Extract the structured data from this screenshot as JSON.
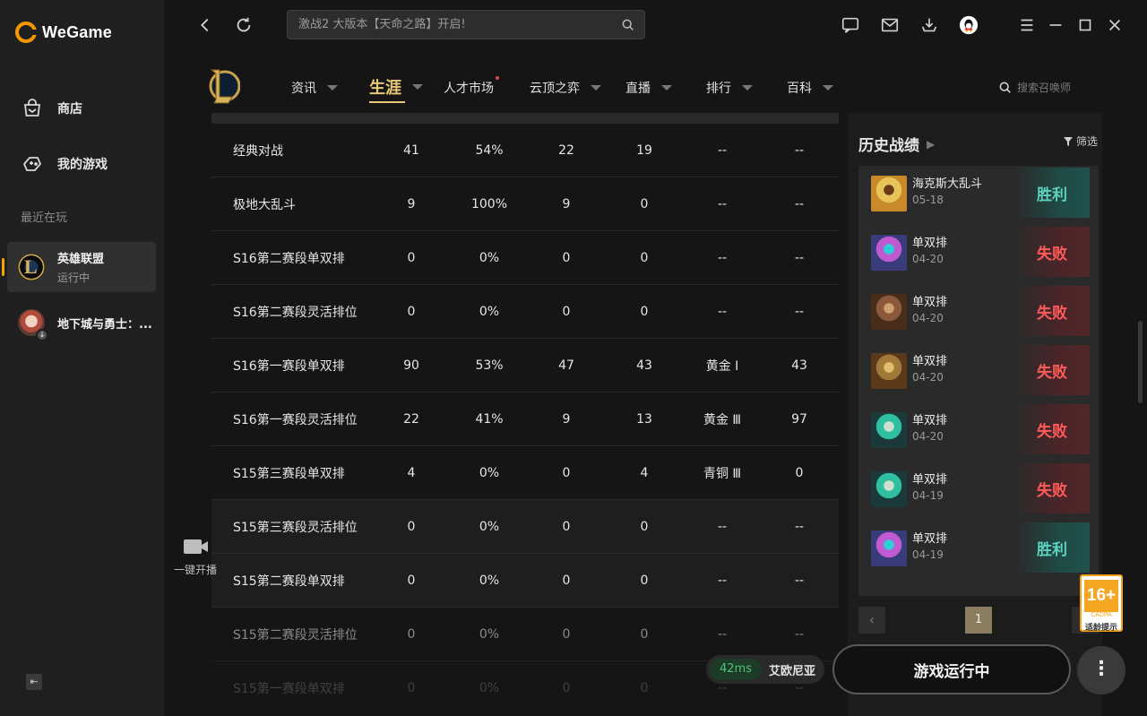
{
  "brand": {
    "name": "WeGame"
  },
  "sidebar": {
    "nav": [
      {
        "label": "商店",
        "icon": "shopping-bag-icon"
      },
      {
        "label": "我的游戏",
        "icon": "gamepad-icon"
      }
    ],
    "recent_label": "最近在玩",
    "games": [
      {
        "name": "英雄联盟",
        "status": "运行中",
        "active": true
      },
      {
        "name": "地下城与勇士：...",
        "status": "",
        "active": false
      }
    ]
  },
  "topbar": {
    "search_placeholder": "激战2 大版本【天命之路】开启!"
  },
  "gamenav": {
    "tabs": [
      {
        "label": "资讯",
        "active": false,
        "dot": false
      },
      {
        "label": "生涯",
        "active": true,
        "dot": false
      },
      {
        "label": "人才市场",
        "active": false,
        "dot": true
      },
      {
        "label": "云顶之弈",
        "active": false,
        "dot": false
      },
      {
        "label": "直播",
        "active": false,
        "dot": false
      },
      {
        "label": "排行",
        "active": false,
        "dot": false
      },
      {
        "label": "百科",
        "active": false,
        "dot": false
      }
    ],
    "search_placeholder": "搜索召唤师"
  },
  "stats_table": {
    "rows": [
      [
        "经典对战",
        "41",
        "54%",
        "22",
        "19",
        "--",
        "--"
      ],
      [
        "极地大乱斗",
        "9",
        "100%",
        "9",
        "0",
        "--",
        "--"
      ],
      [
        "S16第二赛段单双排",
        "0",
        "0%",
        "0",
        "0",
        "--",
        "--"
      ],
      [
        "S16第二赛段灵活排位",
        "0",
        "0%",
        "0",
        "0",
        "--",
        "--"
      ],
      [
        "S16第一赛段单双排",
        "90",
        "53%",
        "47",
        "43",
        "黄金 Ⅰ",
        "43"
      ],
      [
        "S16第一赛段灵活排位",
        "22",
        "41%",
        "9",
        "13",
        "黄金 Ⅲ",
        "97"
      ],
      [
        "S15第三赛段单双排",
        "4",
        "0%",
        "0",
        "4",
        "青铜 Ⅲ",
        "0"
      ],
      [
        "S15第三赛段灵活排位",
        "0",
        "0%",
        "0",
        "0",
        "--",
        "--"
      ],
      [
        "S15第二赛段单双排",
        "0",
        "0%",
        "0",
        "0",
        "--",
        "--"
      ],
      [
        "S15第二赛段灵活排位",
        "0",
        "0%",
        "0",
        "0",
        "--",
        "--"
      ],
      [
        "S15第一赛段单双排",
        "0",
        "0%",
        "0",
        "0",
        "--",
        "--"
      ]
    ]
  },
  "stream_button": {
    "label": "一键开播"
  },
  "history": {
    "title": "历史战绩",
    "filter_label": "筛选",
    "matches": [
      {
        "mode": "海克斯大乱斗",
        "date": "05-18",
        "result": "胜利",
        "win": true
      },
      {
        "mode": "单双排",
        "date": "04-20",
        "result": "失败",
        "win": false
      },
      {
        "mode": "单双排",
        "date": "04-20",
        "result": "失败",
        "win": false
      },
      {
        "mode": "单双排",
        "date": "04-20",
        "result": "失败",
        "win": false
      },
      {
        "mode": "单双排",
        "date": "04-20",
        "result": "失败",
        "win": false
      },
      {
        "mode": "单双排",
        "date": "04-19",
        "result": "失败",
        "win": false
      },
      {
        "mode": "单双排",
        "date": "04-19",
        "result": "胜利",
        "win": true
      }
    ],
    "current_page": "1"
  },
  "age_rating": {
    "age": "16+",
    "org": "CADPA",
    "tip": "适龄提示"
  },
  "server": {
    "ping": "42ms",
    "name": "艾欧尼亚"
  },
  "play_button": {
    "label": "游戏运行中"
  },
  "more_button": {
    "label": "⋮"
  },
  "colors": {
    "accent": "#e8c777",
    "win": "#5fd2bf",
    "loss": "#ff5a5a",
    "brand": "#f39800"
  }
}
